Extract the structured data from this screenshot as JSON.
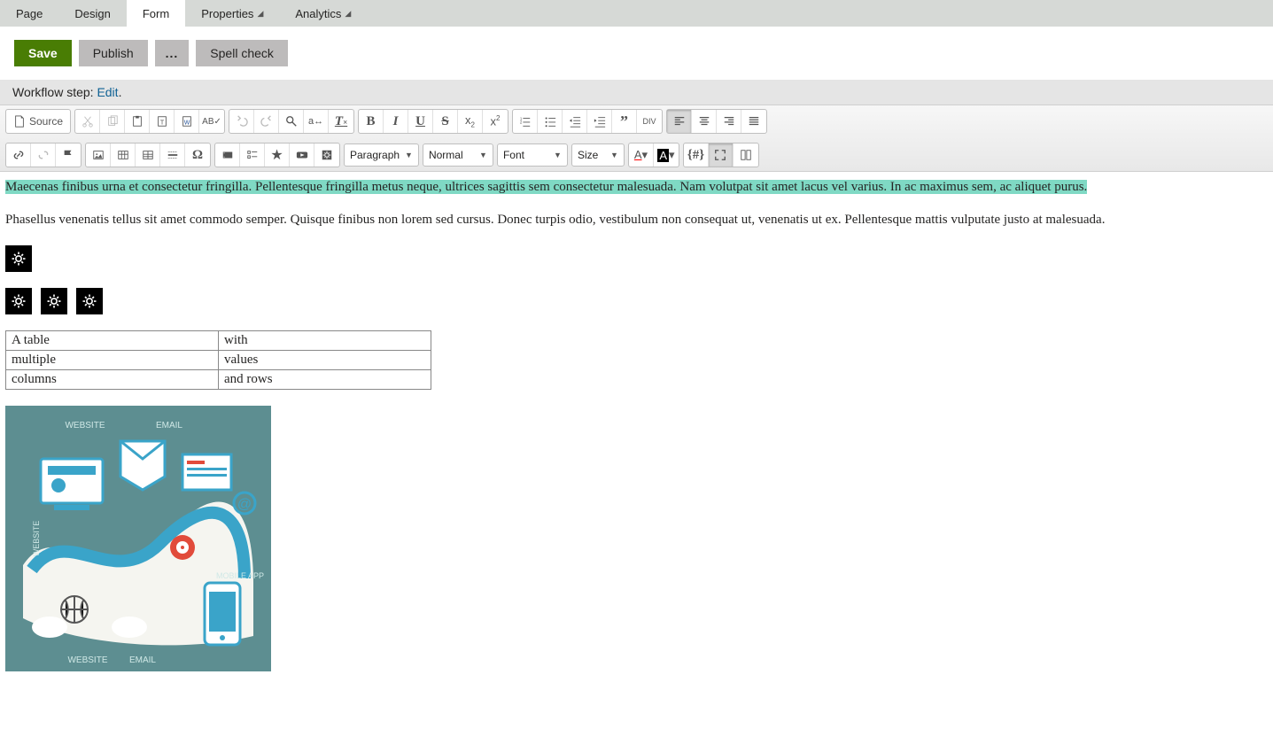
{
  "tabs": [
    {
      "label": "Page",
      "hasMenu": false,
      "active": false
    },
    {
      "label": "Design",
      "hasMenu": false,
      "active": false
    },
    {
      "label": "Form",
      "hasMenu": false,
      "active": true
    },
    {
      "label": "Properties",
      "hasMenu": true,
      "active": false
    },
    {
      "label": "Analytics",
      "hasMenu": true,
      "active": false
    }
  ],
  "actions": {
    "save": "Save",
    "publish": "Publish",
    "more": "...",
    "spell": "Spell check"
  },
  "workflow": {
    "prefix": "Workflow step: ",
    "link": "Edit",
    "suffix": "."
  },
  "toolbar": {
    "source": "Source",
    "sel_paragraph": "Paragraph",
    "sel_normal": "Normal",
    "sel_font": "Font",
    "sel_size": "Size"
  },
  "content": {
    "p1": "Maecenas finibus urna et consectetur fringilla. Pellentesque fringilla metus neque, ultrices sagittis sem consectetur malesuada. Nam volutpat sit amet lacus vel varius. In ac maximus sem, ac aliquet purus.",
    "p2": "Phasellus venenatis tellus sit amet commodo semper. Quisque finibus non lorem sed cursus. Donec turpis odio, vestibulum non consequat ut, venenatis ut ex. Pellentesque mattis vulputate justo at malesuada.",
    "table": [
      [
        "A table",
        "with"
      ],
      [
        "multiple",
        "values"
      ],
      [
        "columns",
        "and rows"
      ]
    ],
    "image_labels": [
      "WEBSITE",
      "EMAIL",
      "MOBILE APP"
    ]
  }
}
